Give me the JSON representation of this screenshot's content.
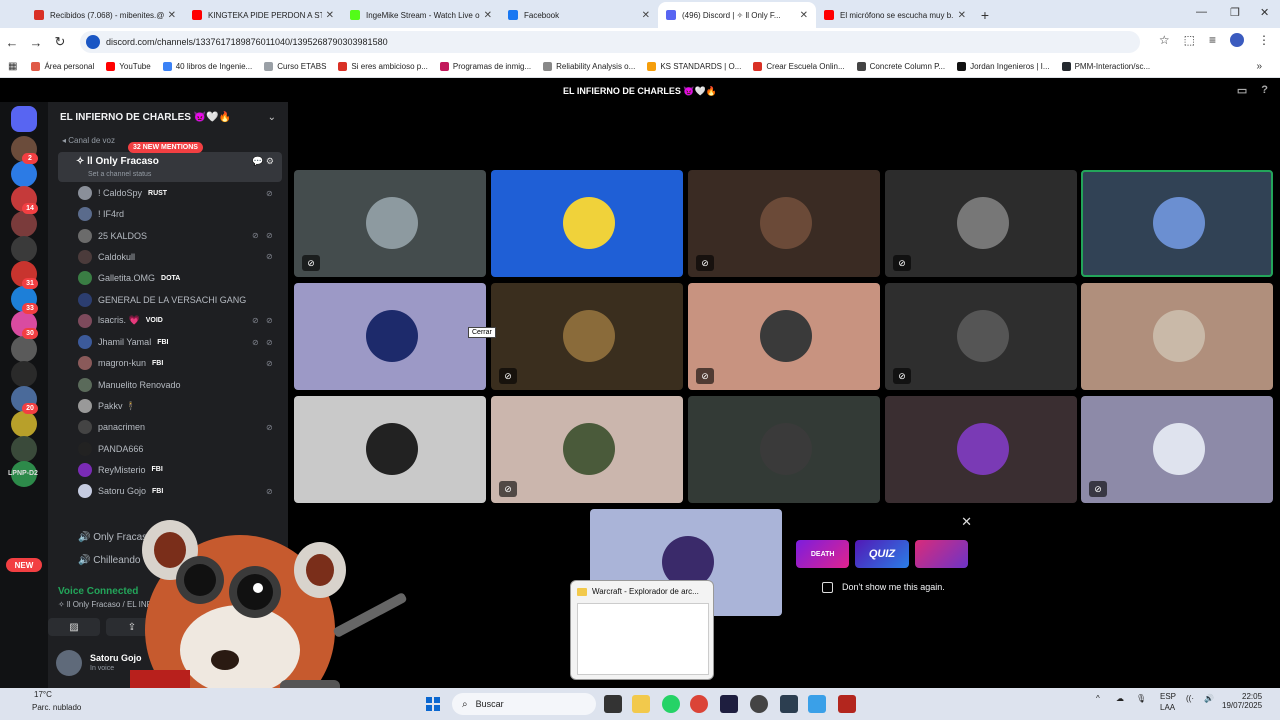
{
  "browser": {
    "tabs": [
      {
        "title": "Recibidos (7.068) - mibenites.@...",
        "color": "#d93025"
      },
      {
        "title": "KINGTEKA PIDE PERDON A STR...",
        "color": "#ff0000"
      },
      {
        "title": "IngeMike Stream - Watch Live o...",
        "color": "#53fc18"
      },
      {
        "title": "Facebook",
        "color": "#1877f2"
      },
      {
        "title": "(496) Discord | ✧ ll Only F...",
        "color": "#5865f2"
      },
      {
        "title": "El micrófono se escucha muy b...",
        "color": "#ff0000"
      }
    ],
    "active_tab": 4,
    "url": "discord.com/channels/1337617189876011040/1395268790303981580",
    "bookmarks": [
      {
        "label": "Área personal",
        "color": "#e05a47"
      },
      {
        "label": "YouTube",
        "color": "#ff0000"
      },
      {
        "label": "40 libros de Ingenie...",
        "color": "#3b82f6"
      },
      {
        "label": "Curso ETABS",
        "color": "#9aa0a6"
      },
      {
        "label": "Si eres ambicioso p...",
        "color": "#d93025"
      },
      {
        "label": "Programas de inmig...",
        "color": "#c2185b"
      },
      {
        "label": "Reliability Analysis o...",
        "color": "#888888"
      },
      {
        "label": "KS STANDARDS | O...",
        "color": "#f59e0b"
      },
      {
        "label": "Crear Escuela Onlin...",
        "color": "#d93025"
      },
      {
        "label": "Concrete Column P...",
        "color": "#444444"
      },
      {
        "label": "Jordan Ingenieros | I...",
        "color": "#111111"
      },
      {
        "label": "PMM-Interaction/sc...",
        "color": "#24292f"
      }
    ]
  },
  "discord": {
    "header_title": "EL INFIERNO DE CHARLES 👿🤍🔥",
    "server_name": "EL INFIERNO DE CHARLES 👿🤍🔥",
    "category": "Canal de voz",
    "mentions_badge": "32 NEW MENTIONS",
    "voice_channel": "✧ ll Only Fracaso",
    "channel_status": "Set a channel status",
    "members": [
      {
        "name": "! CaldoSpy",
        "tag": "RUST",
        "muted": true,
        "deaf": false,
        "color": "#8a8f99"
      },
      {
        "name": "! IF4rd",
        "tag": "",
        "muted": false,
        "deaf": false,
        "color": "#5a6b8c"
      },
      {
        "name": "25 KALDOS",
        "tag": "",
        "muted": true,
        "deaf": true,
        "color": "#6b6b6b"
      },
      {
        "name": "Caldokull",
        "tag": "",
        "muted": true,
        "deaf": false,
        "color": "#4b3b3b"
      },
      {
        "name": "Galletita.OMG",
        "tag": "DOTA",
        "muted": false,
        "deaf": false,
        "color": "#3a7d44"
      },
      {
        "name": "GENERAL DE LA VERSACHI GANG",
        "tag": "",
        "muted": false,
        "deaf": false,
        "color": "#2c3e70"
      },
      {
        "name": "lsacris. 💗",
        "tag": "VOID",
        "muted": true,
        "deaf": true,
        "color": "#7d4a5c"
      },
      {
        "name": "Jhamil Yamal",
        "tag": "FBI",
        "muted": true,
        "deaf": true,
        "color": "#3c5a9a"
      },
      {
        "name": "magron-kun",
        "tag": "FBI",
        "muted": true,
        "deaf": false,
        "color": "#8a5a5a"
      },
      {
        "name": "Manuelito Renovado",
        "tag": "",
        "muted": false,
        "deaf": false,
        "color": "#5a6a5a"
      },
      {
        "name": "Pakkv 🕴",
        "tag": "",
        "muted": false,
        "deaf": false,
        "color": "#999999"
      },
      {
        "name": "panacrimen",
        "tag": "",
        "muted": true,
        "deaf": false,
        "color": "#444444"
      },
      {
        "name": "PANDA666",
        "tag": "",
        "muted": false,
        "deaf": false,
        "color": "#222222"
      },
      {
        "name": "ReyMisterio",
        "tag": "FBI",
        "muted": false,
        "deaf": false,
        "color": "#7a2bb5"
      },
      {
        "name": "Satoru Gojo",
        "tag": "FBI",
        "muted": true,
        "deaf": false,
        "color": "#c5cbe0"
      }
    ],
    "other_channels": [
      "Only Fracaso",
      "Chilleando"
    ],
    "voice_connected": "Voice Connected",
    "voice_location": "✧ ll Only Fracaso / EL INFIERNO DE",
    "user": {
      "name": "Satoru Gojo",
      "status": "In voice"
    },
    "tiles": [
      {
        "bg": "#444c4d",
        "av": "#8d9aa0",
        "muted": true,
        "speaking": false
      },
      {
        "bg": "#1f5fd6",
        "av": "#f0d23a",
        "muted": false,
        "speaking": false
      },
      {
        "bg": "#3a2b23",
        "av": "#6b4a38",
        "muted": true,
        "speaking": false
      },
      {
        "bg": "#2c2c2c",
        "av": "#777777",
        "muted": true,
        "speaking": false
      },
      {
        "bg": "#314255",
        "av": "#6b8fd1",
        "muted": false,
        "speaking": true
      },
      {
        "bg": "#9c99c6",
        "av": "#1d2a6b",
        "muted": false,
        "speaking": false
      },
      {
        "bg": "#3a2e1e",
        "av": "#8a6b3a",
        "muted": true,
        "speaking": false
      },
      {
        "bg": "#c89380",
        "av": "#3a3a3a",
        "muted": true,
        "speaking": false
      },
      {
        "bg": "#2e2e2e",
        "av": "#555555",
        "muted": true,
        "speaking": false
      },
      {
        "bg": "#b08f7c",
        "av": "#c9b9a8",
        "muted": false,
        "speaking": false
      },
      {
        "bg": "#c9c9c9",
        "av": "#222222",
        "muted": false,
        "speaking": false
      },
      {
        "bg": "#cbb6ad",
        "av": "#4a5a3a",
        "muted": true,
        "speaking": false
      },
      {
        "bg": "#333a36",
        "av": "#3a3a3a",
        "muted": false,
        "speaking": false
      },
      {
        "bg": "#3a2e31",
        "av": "#7a3ab5",
        "muted": false,
        "speaking": false
      },
      {
        "bg": "#8d8aa8",
        "av": "#dfe3ee",
        "muted": true,
        "speaking": false
      },
      {
        "bg": "#aab4d8",
        "av": "#3a2a6a",
        "muted": false,
        "speaking": false
      }
    ],
    "tooltip": "Cerrar",
    "popup": {
      "banner_1": "DEATH",
      "banner_2": "QUIZ",
      "dont_show": "Don't show me this again."
    },
    "server_badges": [
      "2",
      "14",
      "31",
      "33",
      "30",
      "20"
    ],
    "server_tag": "LPNP-D2",
    "new_badge": "NEW"
  },
  "explorer": {
    "title": "Warcraft - Explorador de arc..."
  },
  "taskbar": {
    "weather_temp": "17°C",
    "weather_desc": "Parc. nublado",
    "search_placeholder": "Buscar",
    "lang": "ESP",
    "lang_sub": "LAA",
    "time": "22:05",
    "date": "19/07/2025"
  }
}
